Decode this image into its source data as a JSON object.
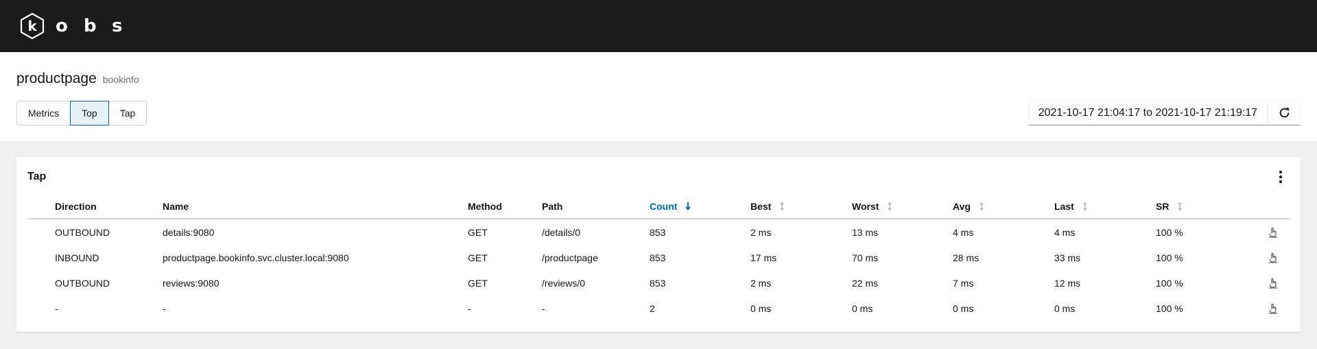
{
  "app": {
    "logo_letters": [
      "o",
      "b",
      "s"
    ]
  },
  "header": {
    "title": "productpage",
    "subtitle": "bookinfo",
    "tabs": [
      {
        "label": "Metrics",
        "active": false
      },
      {
        "label": "Top",
        "active": true
      },
      {
        "label": "Tap",
        "active": false
      }
    ],
    "time_range": "2021-10-17 21:04:17 to 2021-10-17 21:19:17"
  },
  "card": {
    "title": "Tap",
    "columns": [
      "Direction",
      "Name",
      "Method",
      "Path",
      "Count",
      "Best",
      "Worst",
      "Avg",
      "Last",
      "SR"
    ],
    "sorted_column": "Count",
    "rows": [
      [
        "OUTBOUND",
        "details:9080",
        "GET",
        "/details/0",
        "853",
        "2 ms",
        "13 ms",
        "4 ms",
        "4 ms",
        "100 %"
      ],
      [
        "INBOUND",
        "productpage.bookinfo.svc.cluster.local:9080",
        "GET",
        "/productpage",
        "853",
        "17 ms",
        "70 ms",
        "28 ms",
        "33 ms",
        "100 %"
      ],
      [
        "OUTBOUND",
        "reviews:9080",
        "GET",
        "/reviews/0",
        "853",
        "2 ms",
        "22 ms",
        "7 ms",
        "12 ms",
        "100 %"
      ],
      [
        "-",
        "-",
        "-",
        "-",
        "2",
        "0 ms",
        "0 ms",
        "0 ms",
        "0 ms",
        "100 %"
      ]
    ]
  },
  "icons": {
    "logo": "kobs-hexagon-k-logo",
    "refresh": "refresh-icon",
    "kebab": "kebab-menu-icon",
    "sort_desc": "sort-down-arrow-icon",
    "sort_both": "sort-updown-icon",
    "row_action": "tap-hand-icon"
  },
  "colors": {
    "masthead": "#1b1b1b",
    "accent": "#0066cc",
    "active_tab_bg": "#e7f1fa"
  }
}
